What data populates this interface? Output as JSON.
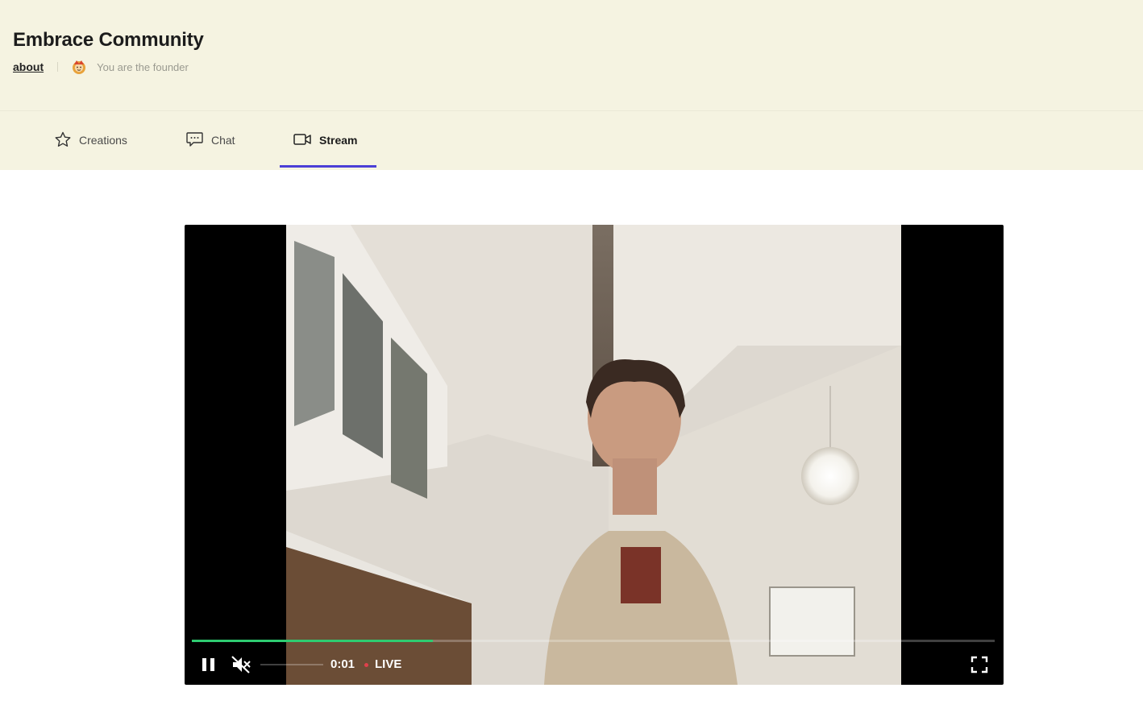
{
  "header": {
    "title": "Embrace Community",
    "about_label": "about",
    "founder_text": "You are the founder"
  },
  "tabs": [
    {
      "label": "Creations",
      "icon": "star-icon",
      "active": false
    },
    {
      "label": "Chat",
      "icon": "chat-bubble-icon",
      "active": false
    },
    {
      "label": "Stream",
      "icon": "video-camera-icon",
      "active": true
    }
  ],
  "player": {
    "time": "0:01",
    "live_label": "LIVE",
    "progress_fraction": 0.3,
    "volume_fraction": 0,
    "muted": true,
    "playing": true
  },
  "colors": {
    "header_bg": "#f5f3e1",
    "accent": "#4b3fd6",
    "progress": "#2ecc71",
    "live_dot": "#e0404b"
  }
}
